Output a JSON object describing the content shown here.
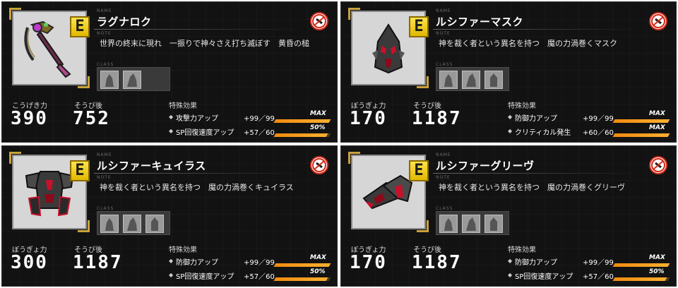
{
  "labels": {
    "name": "NAME",
    "note": "NOTE",
    "class": "CLASS",
    "after": "そうび後",
    "effects": "特殊効果"
  },
  "cards": [
    {
      "rank": "E",
      "name": "ラグナロク",
      "note": "世界の終末に現れ　一振りで神々さえ打ち滅ぼす　黄昏の槌",
      "stat_label": "こうげき力",
      "stat": "390",
      "after": "752",
      "effects": [
        {
          "name": "攻撃力アップ",
          "value": "+99／99",
          "tag": "MAX",
          "fill": 1.0
        },
        {
          "name": "SP回復速度アップ",
          "value": "+57／60",
          "tag": "50%",
          "fill": 0.95
        }
      ]
    },
    {
      "rank": "E",
      "name": "ルシファーマスク",
      "note": "神を裁く者という異名を持つ　魔の力渦巻くマスク",
      "stat_label": "ぼうぎょ力",
      "stat": "170",
      "after": "1187",
      "effects": [
        {
          "name": "防御力アップ",
          "value": "+99／99",
          "tag": "MAX",
          "fill": 1.0
        },
        {
          "name": "クリティカル発生",
          "value": "+60／60",
          "tag": "MAX",
          "fill": 1.0
        }
      ]
    },
    {
      "rank": "E",
      "name": "ルシファーキュイラス",
      "note": "神を裁く者という異名を持つ　魔の力渦巻くキュイラス",
      "stat_label": "ぼうぎょ力",
      "stat": "300",
      "after": "1187",
      "effects": [
        {
          "name": "防御力アップ",
          "value": "+99／99",
          "tag": "MAX",
          "fill": 1.0
        },
        {
          "name": "SP回復速度アップ",
          "value": "+57／60",
          "tag": "50%",
          "fill": 0.95
        }
      ]
    },
    {
      "rank": "E",
      "name": "ルシファーグリーヴ",
      "note": "神を裁く者という異名を持つ　魔の力渦巻くグリーヴ",
      "stat_label": "ぼうぎょ力",
      "stat": "170",
      "after": "1187",
      "effects": [
        {
          "name": "防御力アップ",
          "value": "+99／99",
          "tag": "MAX",
          "fill": 1.0
        },
        {
          "name": "SP回復速度アップ",
          "value": "+57／60",
          "tag": "50%",
          "fill": 0.95
        }
      ]
    }
  ],
  "icons": [
    "warhammer-icon",
    "mask-icon",
    "cuirass-icon",
    "greaves-icon",
    "no-trade-icon",
    "class-silhouette-icon"
  ],
  "colors": {
    "rank_yellow": "#ffe44a",
    "bar_orange": "#f08a10",
    "no_red": "#d22a1a"
  }
}
